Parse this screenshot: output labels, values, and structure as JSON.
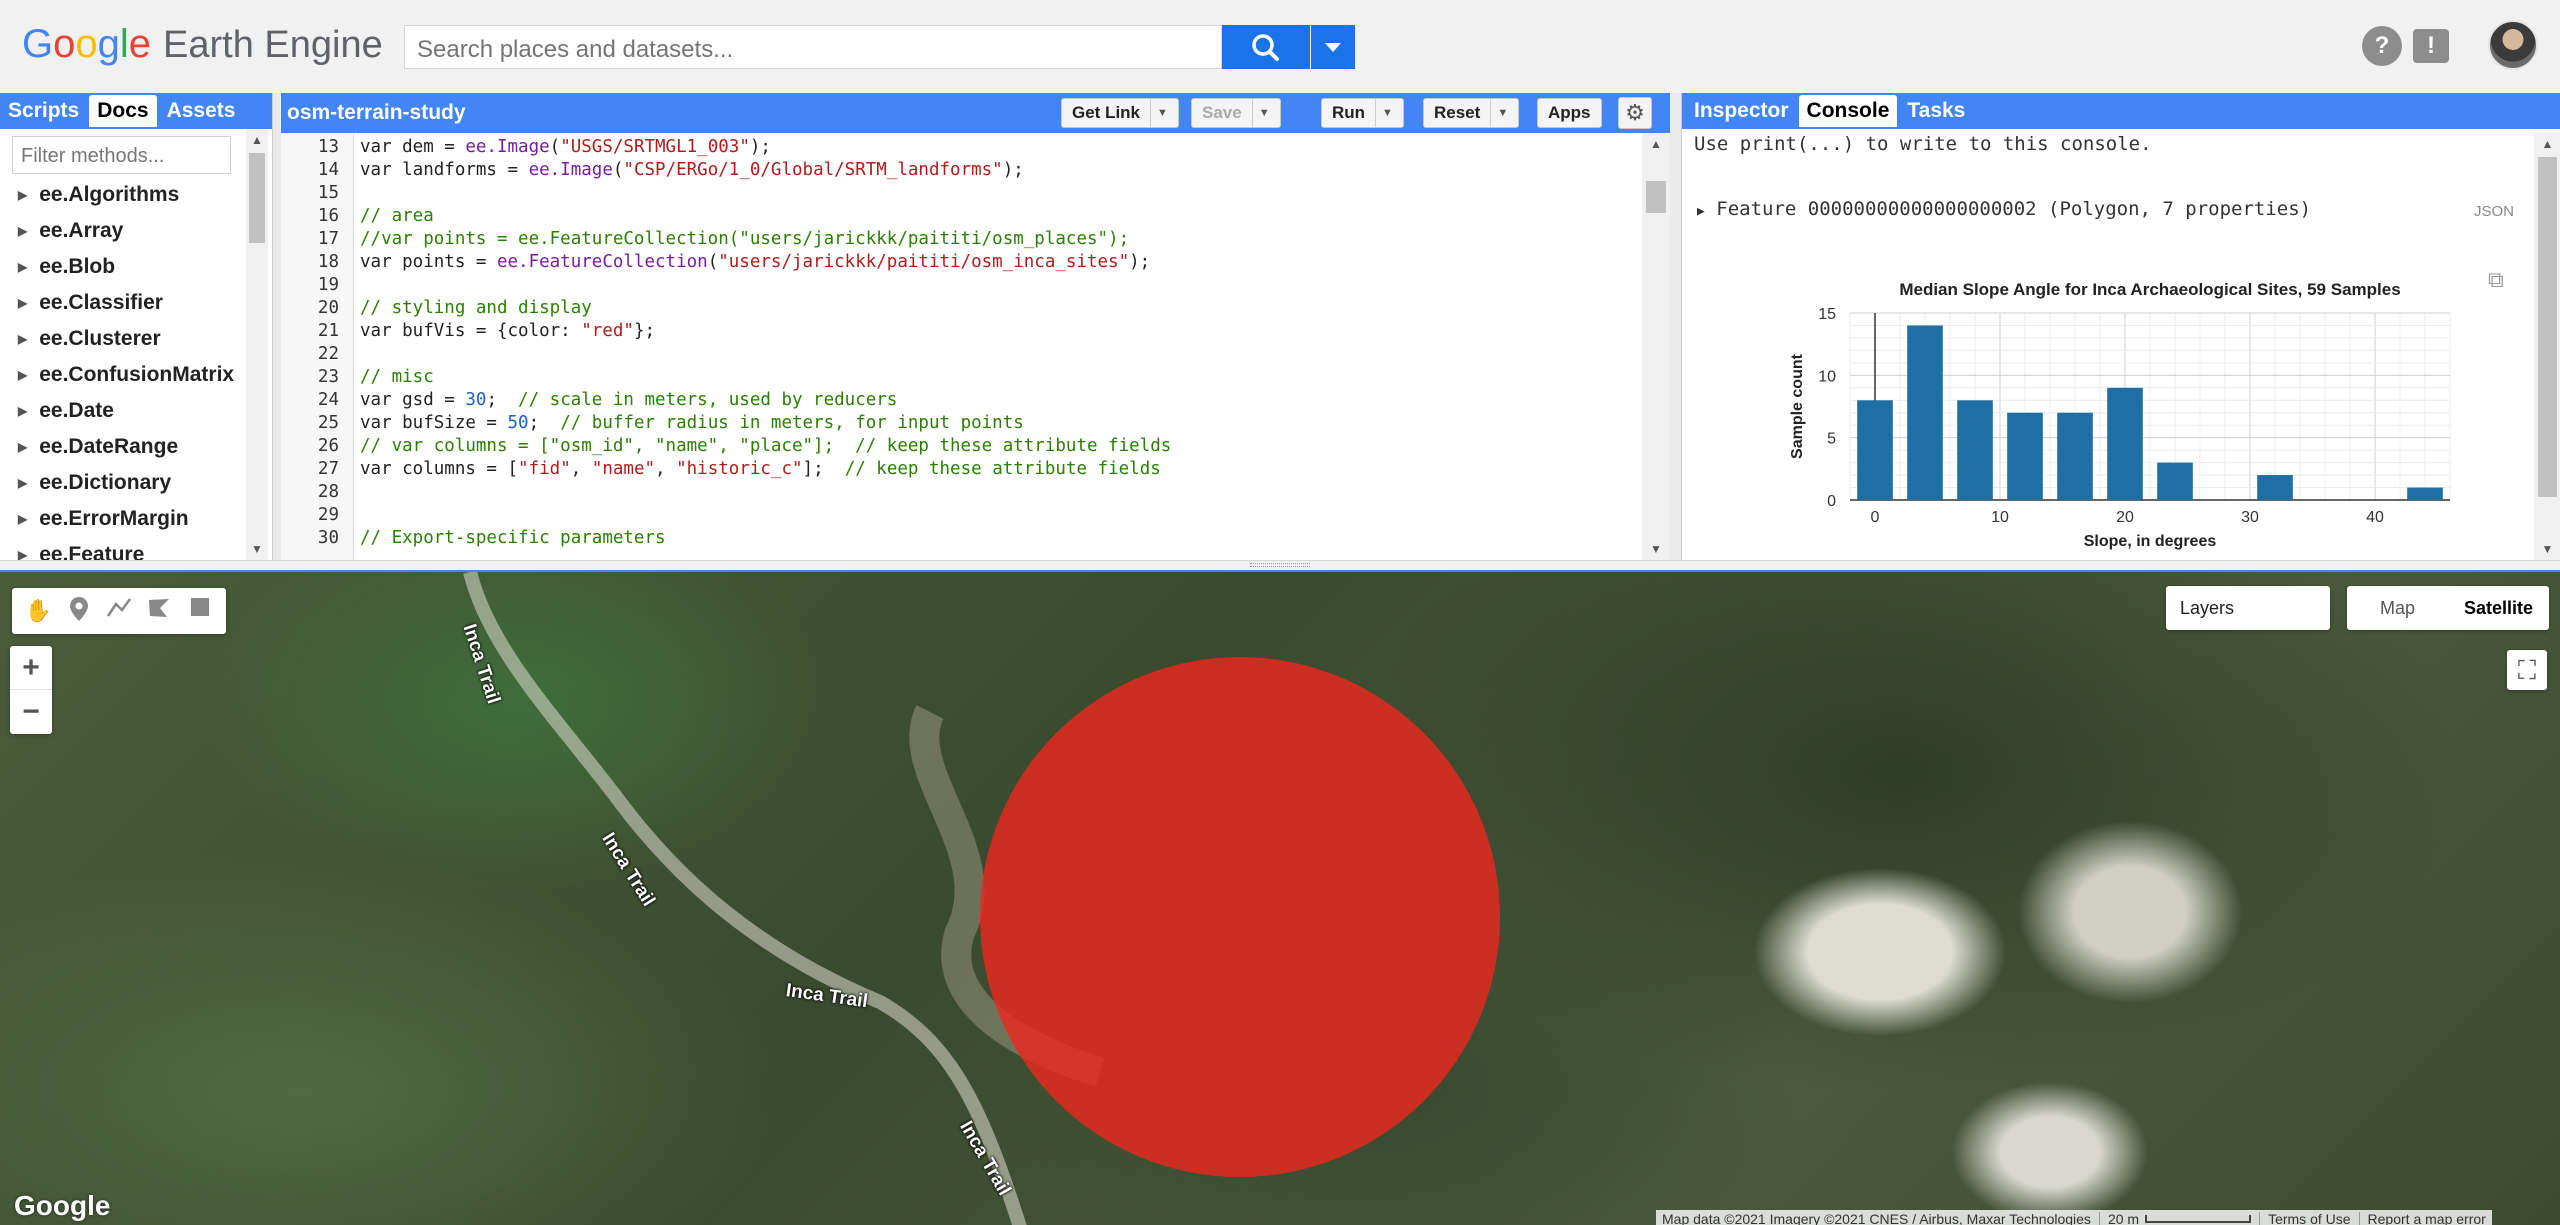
{
  "header": {
    "logo_google": [
      "G",
      "o",
      "o",
      "g",
      "l",
      "e"
    ],
    "logo_colors": [
      "#4285f4",
      "#ea4335",
      "#fbbc05",
      "#4285f4",
      "#34a853",
      "#ea4335"
    ],
    "logo_product": "Earth Engine",
    "search_placeholder": "Search places and datasets...",
    "help_icon": "?",
    "feedback_icon": "!"
  },
  "left_panel": {
    "tabs": [
      "Scripts",
      "Docs",
      "Assets"
    ],
    "active_tab": "Docs",
    "filter_placeholder": "Filter methods...",
    "items": [
      "ee.Algorithms",
      "ee.Array",
      "ee.Blob",
      "ee.Classifier",
      "ee.Clusterer",
      "ee.ConfusionMatrix",
      "ee.Date",
      "ee.DateRange",
      "ee.Dictionary",
      "ee.ErrorMargin",
      "ee.Feature"
    ]
  },
  "editor": {
    "script_name": "osm-terrain-study",
    "buttons": {
      "get_link": "Get Link",
      "save": "Save",
      "run": "Run",
      "reset": "Reset",
      "apps": "Apps"
    },
    "lines": [
      {
        "n": "13",
        "parts": [
          [
            "",
            "var dem = "
          ],
          [
            "kw",
            "ee.Image"
          ],
          [
            "",
            "("
          ],
          [
            "str",
            "\"USGS/SRTMGL1_003\""
          ],
          [
            "",
            ");"
          ]
        ]
      },
      {
        "n": "14",
        "parts": [
          [
            "",
            "var landforms = "
          ],
          [
            "kw",
            "ee.Image"
          ],
          [
            "",
            "("
          ],
          [
            "str",
            "\"CSP/ERGo/1_0/Global/SRTM_landforms\""
          ],
          [
            "",
            ");"
          ]
        ]
      },
      {
        "n": "15",
        "parts": []
      },
      {
        "n": "16",
        "parts": [
          [
            "cm",
            "// area"
          ]
        ]
      },
      {
        "n": "17",
        "parts": [
          [
            "cm",
            "//var points = ee.FeatureCollection(\"users/jarickkk/paititi/osm_places\");"
          ]
        ]
      },
      {
        "n": "18",
        "parts": [
          [
            "",
            "var points = "
          ],
          [
            "kw",
            "ee.FeatureCollection"
          ],
          [
            "",
            "("
          ],
          [
            "str",
            "\"users/jarickkk/paititi/osm_inca_sites\""
          ],
          [
            "",
            ");"
          ]
        ]
      },
      {
        "n": "19",
        "parts": []
      },
      {
        "n": "20",
        "parts": [
          [
            "cm",
            "// styling and display"
          ]
        ]
      },
      {
        "n": "21",
        "parts": [
          [
            "",
            "var bufVis = {color: "
          ],
          [
            "str",
            "\"red\""
          ],
          [
            "",
            "};"
          ]
        ]
      },
      {
        "n": "22",
        "parts": []
      },
      {
        "n": "23",
        "parts": [
          [
            "cm",
            "// misc"
          ]
        ]
      },
      {
        "n": "24",
        "parts": [
          [
            "",
            "var gsd = "
          ],
          [
            "num",
            "30"
          ],
          [
            "",
            ";  "
          ],
          [
            "cm",
            "// scale in meters, used by reducers"
          ]
        ]
      },
      {
        "n": "25",
        "parts": [
          [
            "",
            "var bufSize = "
          ],
          [
            "num",
            "50"
          ],
          [
            "",
            ";  "
          ],
          [
            "cm",
            "// buffer radius in meters, for input points"
          ]
        ]
      },
      {
        "n": "26",
        "parts": [
          [
            "cm",
            "// var columns = [\"osm_id\", \"name\", \"place\"];  // keep these attribute fields"
          ]
        ]
      },
      {
        "n": "27",
        "parts": [
          [
            "",
            "var columns = ["
          ],
          [
            "str",
            "\"fid\""
          ],
          [
            "",
            ", "
          ],
          [
            "str",
            "\"name\""
          ],
          [
            "",
            ", "
          ],
          [
            "str",
            "\"historic_c\""
          ],
          [
            "",
            "];  "
          ],
          [
            "cm",
            "// keep these attribute fields"
          ]
        ]
      },
      {
        "n": "28",
        "parts": []
      },
      {
        "n": "29",
        "parts": []
      },
      {
        "n": "30",
        "parts": [
          [
            "cm",
            "// Export-specific parameters"
          ]
        ]
      }
    ]
  },
  "right_panel": {
    "tabs": [
      "Inspector",
      "Console",
      "Tasks"
    ],
    "active_tab": "Console",
    "console_hint": "Use print(...) to write to this console.",
    "feature_line": "Feature 00000000000000000002 (Polygon, 7 properties)",
    "json_label": "JSON"
  },
  "chart_data": {
    "type": "bar",
    "title": "Median Slope Angle for Inca Archaeological Sites, 59 Samples",
    "xlabel": "Slope, in degrees",
    "ylabel": "Sample count",
    "x": [
      0,
      4,
      8,
      12,
      16,
      20,
      24,
      32,
      44
    ],
    "values": [
      8,
      14,
      8,
      7,
      7,
      9,
      3,
      2,
      1
    ],
    "xlim": [
      -2,
      46
    ],
    "ylim": [
      0,
      15
    ],
    "xticks": [
      0,
      10,
      20,
      30,
      40
    ],
    "yticks": [
      0,
      5,
      10,
      15
    ],
    "bar_color": "#1f6fa4",
    "grid": true
  },
  "map": {
    "trail_label": "Inca Trail",
    "layers_label": "Layers",
    "map_type_options": [
      "Map",
      "Satellite"
    ],
    "map_type_selected": "Satellite",
    "zoom_in": "+",
    "zoom_out": "−",
    "google_logo": "Google",
    "attribution": "Map data ©2021 Imagery ©2021 CNES / Airbus, Maxar Technologies",
    "scale_label": "20 m",
    "terms": "Terms of Use",
    "report": "Report a map error",
    "buffer_color": "#eb281e"
  }
}
